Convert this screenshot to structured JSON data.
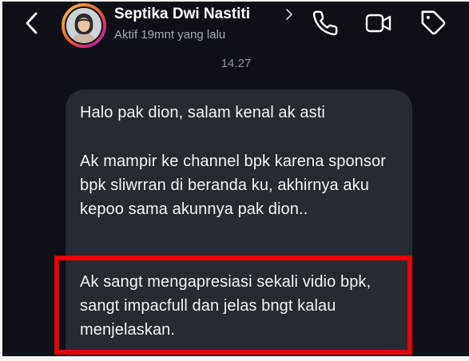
{
  "header": {
    "contact_name": "Septika Dwi Nastiti",
    "status": "Aktif 19mnt yang lalu",
    "icons": [
      "back-arrow-icon",
      "chevron-right-icon",
      "phone-icon",
      "video-camera-icon",
      "tag-icon"
    ]
  },
  "thread": {
    "timestamp": "14.27",
    "message": {
      "paragraph_1": "Halo pak dion, salam kenal ak asti",
      "paragraph_2": "Ak mampir ke channel bpk karena sponsor bpk sliwrran di beranda ku, akhirnya aku kepoo sama akunnya pak dion..",
      "paragraph_3": "Ak sangt mengapresiasi sekali vidio bpk, sangt impacfull dan jelas bngt kalau menjelaskan."
    }
  },
  "colors": {
    "background": "#0d1117",
    "bubble": "#262a31",
    "highlight": "#e8000b",
    "text": "#f3f4f6",
    "muted_text": "#a4a9b1"
  }
}
